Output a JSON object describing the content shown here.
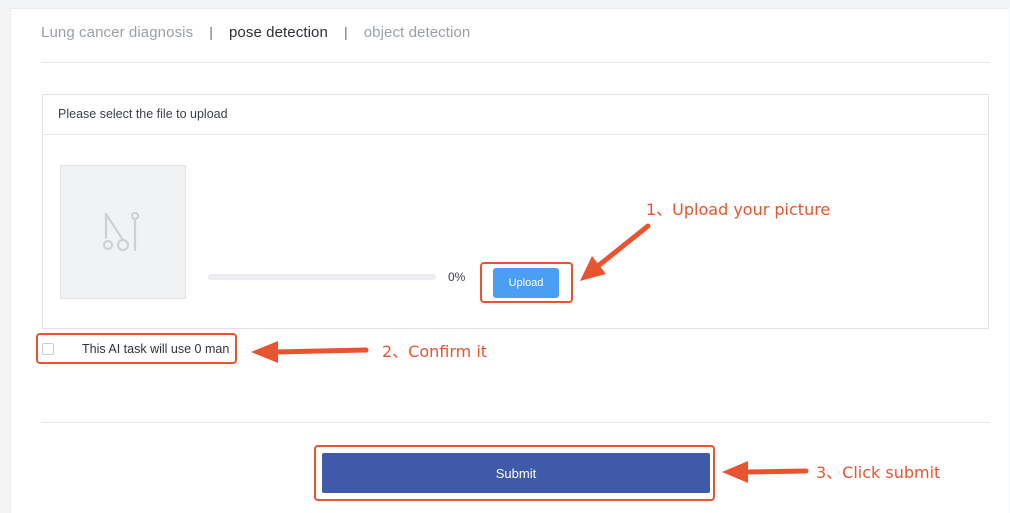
{
  "tabs": [
    {
      "label": "Lung cancer diagnosis",
      "active": false
    },
    {
      "label": "pose detection",
      "active": true
    },
    {
      "label": "object detection",
      "active": false
    }
  ],
  "tab_separator": "|",
  "upload_panel": {
    "header": "Please select the file to upload",
    "thumbnail_icon": "image-placeholder-icon",
    "progress_percent": 0,
    "progress_text": "0%",
    "upload_button_label": "Upload"
  },
  "confirm": {
    "checked": false,
    "label": "This AI task will use 0 man"
  },
  "submit_button_label": "Submit",
  "annotations": {
    "step1": "1、Upload your picture",
    "step2": "2、Confirm it",
    "step3": "3、Click submit"
  },
  "colors": {
    "accent": "#4a9ff5",
    "submit": "#3f5aa9",
    "annotation": "#e8542f"
  }
}
